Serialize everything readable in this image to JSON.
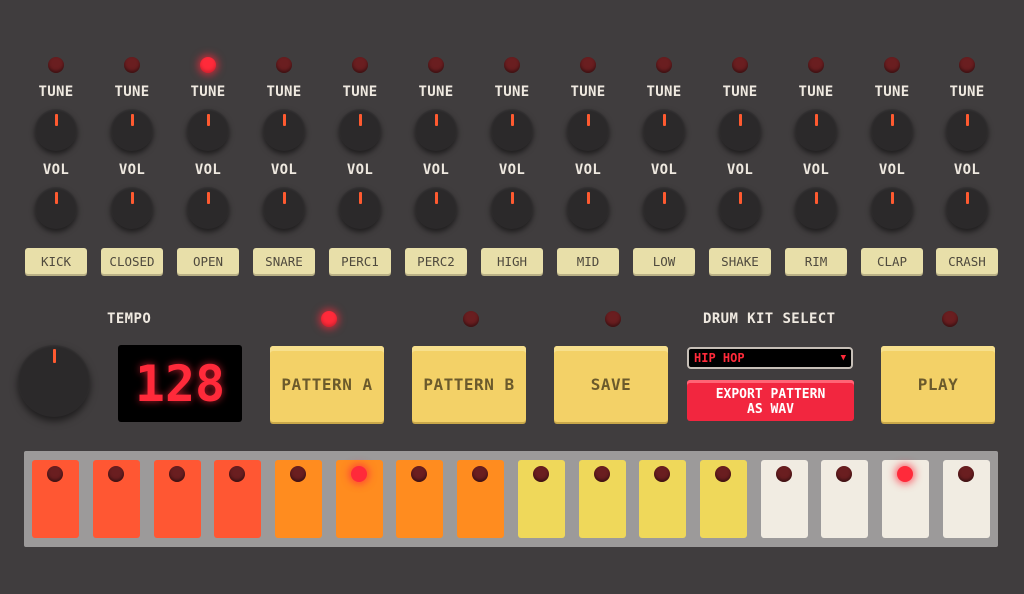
{
  "colors": {
    "background": "#403d3e",
    "led_off": "#6a1e20",
    "led_on": "#ff2a3a",
    "knob_pointer": "#ff5a30",
    "channel_button": "#e8dfa9",
    "pad_button": "#f3d167",
    "export_button": "#f2263f",
    "step_group_colors": [
      "#ff5733",
      "#ff8c1f",
      "#efd85a",
      "#f1ece2"
    ]
  },
  "channels": [
    {
      "name": "KICK",
      "tune_label": "TUNE",
      "vol_label": "VOL",
      "led_on": false
    },
    {
      "name": "CLOSED",
      "tune_label": "TUNE",
      "vol_label": "VOL",
      "led_on": false
    },
    {
      "name": "OPEN",
      "tune_label": "TUNE",
      "vol_label": "VOL",
      "led_on": true
    },
    {
      "name": "SNARE",
      "tune_label": "TUNE",
      "vol_label": "VOL",
      "led_on": false
    },
    {
      "name": "PERC1",
      "tune_label": "TUNE",
      "vol_label": "VOL",
      "led_on": false
    },
    {
      "name": "PERC2",
      "tune_label": "TUNE",
      "vol_label": "VOL",
      "led_on": false
    },
    {
      "name": "HIGH",
      "tune_label": "TUNE",
      "vol_label": "VOL",
      "led_on": false
    },
    {
      "name": "MID",
      "tune_label": "TUNE",
      "vol_label": "VOL",
      "led_on": false
    },
    {
      "name": "LOW",
      "tune_label": "TUNE",
      "vol_label": "VOL",
      "led_on": false
    },
    {
      "name": "SHAKE",
      "tune_label": "TUNE",
      "vol_label": "VOL",
      "led_on": false
    },
    {
      "name": "RIM",
      "tune_label": "TUNE",
      "vol_label": "VOL",
      "led_on": false
    },
    {
      "name": "CLAP",
      "tune_label": "TUNE",
      "vol_label": "VOL",
      "led_on": false
    },
    {
      "name": "CRASH",
      "tune_label": "TUNE",
      "vol_label": "VOL",
      "led_on": false
    }
  ],
  "tempo": {
    "label": "TEMPO",
    "value": "128"
  },
  "pattern_a": {
    "label": "PATTERN A",
    "led_on": true
  },
  "pattern_b": {
    "label": "PATTERN B",
    "led_on": false
  },
  "save": {
    "label": "SAVE",
    "led_on": false
  },
  "drum_kit": {
    "label": "DRUM KIT SELECT",
    "selected": "HIP HOP",
    "export_line1": "EXPORT PATTERN",
    "export_line2": "AS WAV"
  },
  "play": {
    "label": "PLAY",
    "led_on": false
  },
  "sequencer": {
    "steps": [
      {
        "group": 0,
        "led_on": false
      },
      {
        "group": 0,
        "led_on": false
      },
      {
        "group": 0,
        "led_on": false
      },
      {
        "group": 0,
        "led_on": false
      },
      {
        "group": 1,
        "led_on": false
      },
      {
        "group": 1,
        "led_on": true
      },
      {
        "group": 1,
        "led_on": false
      },
      {
        "group": 1,
        "led_on": false
      },
      {
        "group": 2,
        "led_on": false
      },
      {
        "group": 2,
        "led_on": false
      },
      {
        "group": 2,
        "led_on": false
      },
      {
        "group": 2,
        "led_on": false
      },
      {
        "group": 3,
        "led_on": false
      },
      {
        "group": 3,
        "led_on": false
      },
      {
        "group": 3,
        "led_on": true
      },
      {
        "group": 3,
        "led_on": false
      }
    ]
  }
}
